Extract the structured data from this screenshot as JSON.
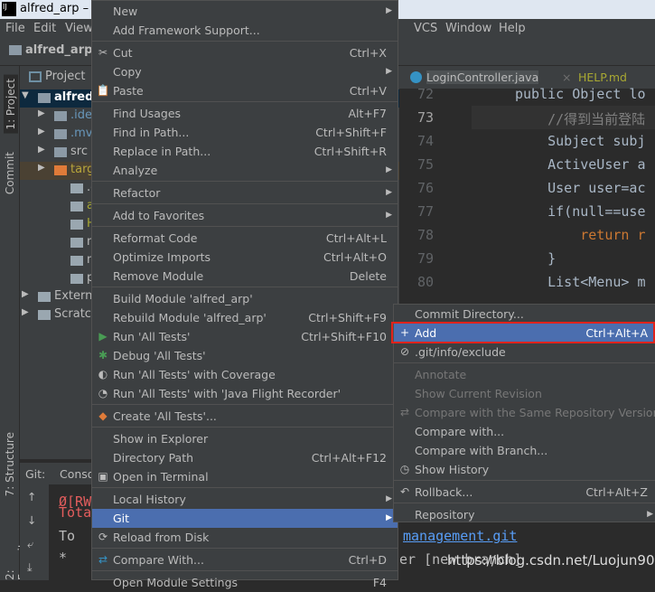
{
  "window": {
    "title": "alfred_arp – L"
  },
  "menubar": [
    "File",
    "Edit",
    "View",
    "VCS",
    "Window",
    "Help"
  ],
  "navbar": {
    "project": "alfred_arp"
  },
  "left_tabs": {
    "project": "1: Project",
    "commit": "Commit",
    "structure": "7: Structure",
    "favorites": "2: Favorites"
  },
  "project_panel": {
    "header": "Project",
    "items": [
      {
        "label": "alfred_",
        "icon": "module-folder-icon"
      },
      {
        "label": ".ide",
        "icon": "folder-icon"
      },
      {
        "label": ".mv",
        "icon": "folder-icon"
      },
      {
        "label": "src",
        "icon": "folder-icon"
      },
      {
        "label": "targ",
        "icon": "orange-folder-icon"
      },
      {
        "label": ".giti",
        "icon": "ignore-file-icon"
      },
      {
        "label": "alfr",
        "icon": "file-icon"
      },
      {
        "label": "HEL",
        "icon": "markdown-icon"
      },
      {
        "label": "mvr",
        "icon": "shell-icon"
      },
      {
        "label": "mvr",
        "icon": "text-file-icon"
      },
      {
        "label": "por",
        "icon": "maven-icon"
      },
      {
        "label": "Externa",
        "icon": "library-icon"
      },
      {
        "label": "Scratch",
        "icon": "scratch-icon"
      }
    ]
  },
  "git_panel": {
    "tabs": [
      "Git:",
      "Conso"
    ],
    "lines": [
      "Ø[RW",
      "Tota",
      "To ",
      "*"
    ]
  },
  "editor": {
    "tabs": [
      "LoginController.java",
      "HELP.md"
    ],
    "lines": [
      {
        "n": "72",
        "text": "public Object lo"
      },
      {
        "n": "73",
        "text": "    //得到当前登陆"
      },
      {
        "n": "74",
        "text": "    Subject subj"
      },
      {
        "n": "75",
        "text": "    ActiveUser a"
      },
      {
        "n": "76",
        "text": "    User user=ac"
      },
      {
        "n": "77",
        "text": "    if(null==use"
      },
      {
        "n": "78",
        "text": "        return r"
      },
      {
        "n": "79",
        "text": "    }"
      },
      {
        "n": "80",
        "text": "    List<Menu> m"
      }
    ],
    "console_link": "management.git",
    "console_line": "er [new branch]"
  },
  "context_menu": [
    {
      "label": "New",
      "arrow": true
    },
    {
      "label": "Add Framework Support..."
    },
    {
      "sep": true
    },
    {
      "label": "Cut",
      "shortcut": "Ctrl+X",
      "icon": "✂",
      "iconName": "scissors-icon"
    },
    {
      "label": "Copy",
      "arrow": true
    },
    {
      "label": "Paste",
      "shortcut": "Ctrl+V",
      "icon": "📋",
      "iconName": "clipboard-icon"
    },
    {
      "sep": true
    },
    {
      "label": "Find Usages",
      "shortcut": "Alt+F7"
    },
    {
      "label": "Find in Path...",
      "shortcut": "Ctrl+Shift+F"
    },
    {
      "label": "Replace in Path...",
      "shortcut": "Ctrl+Shift+R"
    },
    {
      "label": "Analyze",
      "arrow": true
    },
    {
      "sep": true
    },
    {
      "label": "Refactor",
      "arrow": true
    },
    {
      "sep": true
    },
    {
      "label": "Add to Favorites",
      "arrow": true
    },
    {
      "sep": true
    },
    {
      "label": "Reformat Code",
      "shortcut": "Ctrl+Alt+L"
    },
    {
      "label": "Optimize Imports",
      "shortcut": "Ctrl+Alt+O"
    },
    {
      "label": "Remove Module",
      "shortcut": "Delete"
    },
    {
      "sep": true
    },
    {
      "label": "Build Module 'alfred_arp'"
    },
    {
      "label": "Rebuild Module 'alfred_arp'",
      "shortcut": "Ctrl+Shift+F9"
    },
    {
      "label": "Run 'All Tests'",
      "shortcut": "Ctrl+Shift+F10",
      "icon": "▶",
      "iconName": "run-icon",
      "iconColor": "#499c54"
    },
    {
      "label": "Debug 'All Tests'",
      "icon": "✱",
      "iconName": "debug-icon",
      "iconColor": "#499c54"
    },
    {
      "label": "Run 'All Tests' with Coverage",
      "icon": "◐",
      "iconName": "coverage-icon"
    },
    {
      "label": "Run 'All Tests' with 'Java Flight Recorder'",
      "icon": "◔",
      "iconName": "profiler-icon"
    },
    {
      "sep": true
    },
    {
      "label": "Create 'All Tests'...",
      "icon": "◆",
      "iconName": "create-test-icon",
      "iconColor": "#e07b39"
    },
    {
      "sep": true
    },
    {
      "label": "Show in Explorer"
    },
    {
      "label": "Directory Path",
      "shortcut": "Ctrl+Alt+F12"
    },
    {
      "label": "Open in Terminal",
      "icon": "▣",
      "iconName": "terminal-icon"
    },
    {
      "sep": true
    },
    {
      "label": "Local History",
      "arrow": true
    },
    {
      "label": "Git",
      "arrow": true,
      "highlighted": true
    },
    {
      "label": "Reload from Disk",
      "icon": "⟳",
      "iconName": "reload-icon"
    },
    {
      "sep": true
    },
    {
      "label": "Compare With...",
      "shortcut": "Ctrl+D",
      "icon": "⇄",
      "iconName": "compare-icon",
      "iconColor": "#3592c4"
    },
    {
      "sep": true
    },
    {
      "label": "Open Module Settings",
      "shortcut": "F4"
    }
  ],
  "git_submenu": [
    {
      "label": "Commit Directory..."
    },
    {
      "label": "Add",
      "shortcut": "Ctrl+Alt+A",
      "icon": "+",
      "iconName": "plus-icon",
      "highlighted": true
    },
    {
      "label": ".git/info/exclude",
      "icon": "⊘",
      "iconName": "ignore-file-icon"
    },
    {
      "sep": true
    },
    {
      "label": "Annotate",
      "disabled": true
    },
    {
      "label": "Show Current Revision",
      "disabled": true
    },
    {
      "label": "Compare with the Same Repository Version",
      "disabled": true,
      "icon": "⇄",
      "iconName": "compare-icon"
    },
    {
      "label": "Compare with..."
    },
    {
      "label": "Compare with Branch..."
    },
    {
      "label": "Show History",
      "icon": "◷",
      "iconName": "history-icon"
    },
    {
      "sep": true
    },
    {
      "label": "Rollback...",
      "shortcut": "Ctrl+Alt+Z",
      "icon": "↶",
      "iconName": "rollback-icon"
    },
    {
      "sep": true
    },
    {
      "label": "Repository",
      "arrow": true
    }
  ],
  "watermark": "https://blog.csdn.net/Luojun904",
  "colors": {
    "highlight": "#4b6eaf",
    "annotation_box": "#e0231c",
    "menu_bg": "#3c3f41"
  }
}
